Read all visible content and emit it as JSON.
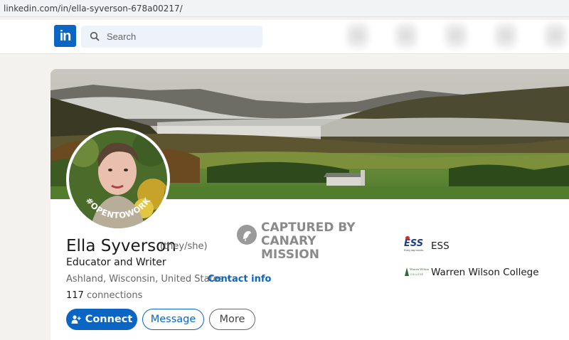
{
  "browser": {
    "url": "linkedin.com/in/ella-syverson-678a00217/"
  },
  "nav": {
    "logo_text": "in",
    "search_placeholder": "Search",
    "search_icon": "search-icon"
  },
  "profile": {
    "name": "Ella Syverson",
    "pronouns": "(they/she)",
    "headline": "Educator and Writer",
    "location": "Ashland, Wisconsin, United States ·",
    "contact_info": "Contact info",
    "connections_count": "117",
    "connections_label": "connections",
    "open_to_work_badge": "#OPENTOWORK"
  },
  "actions": {
    "connect": "Connect",
    "message": "Message",
    "more": "More"
  },
  "organizations": [
    {
      "name": "ESS",
      "logo_text": "ESS",
      "logo_subtext": "Every day counts."
    },
    {
      "name": "Warren Wilson College",
      "logo_text": "Warren Wilson",
      "logo_subtext": "COLLEGE"
    }
  ],
  "watermark": {
    "line1": "CAPTURED BY",
    "line2": "CANARY MISSION"
  },
  "colors": {
    "brand": "#0a66c2",
    "badge_green": "#3b7a3e"
  }
}
